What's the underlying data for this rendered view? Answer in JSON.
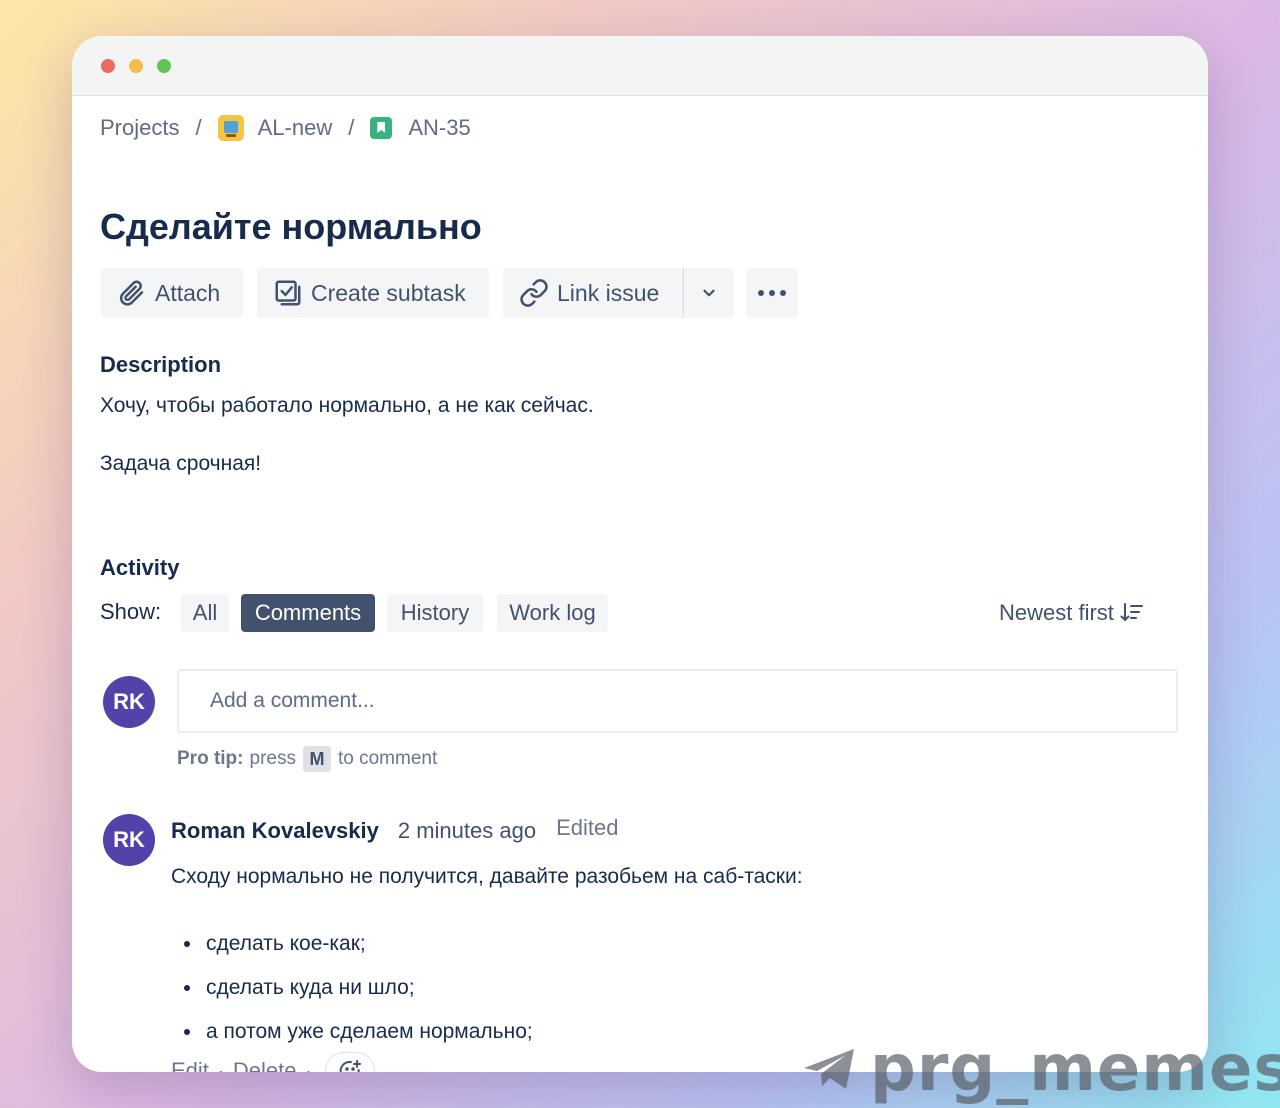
{
  "breadcrumb": {
    "projects": "Projects",
    "separator": "/",
    "project": "AL-new",
    "issue_key": "AN-35"
  },
  "issue": {
    "title": "Сделайте нормально"
  },
  "toolbar": {
    "attach": "Attach",
    "create_subtask": "Create subtask",
    "link_issue": "Link issue"
  },
  "description": {
    "heading": "Description",
    "paragraphs": [
      "Хочу, чтобы работало нормально, а не как сейчас.",
      "Задача срочная!"
    ]
  },
  "activity": {
    "heading": "Activity",
    "show_label": "Show:",
    "filters": [
      "All",
      "Comments",
      "History",
      "Work log"
    ],
    "active_filter": "Comments",
    "sort": "Newest first"
  },
  "comment_box": {
    "avatar_initials": "RK",
    "placeholder": "Add a comment...",
    "protip_label": "Pro tip:",
    "protip_before": "press",
    "protip_key": "M",
    "protip_after": "to comment"
  },
  "comment": {
    "avatar_initials": "RK",
    "author": "Roman Kovalevskiy",
    "time": "2 minutes ago",
    "edited": "Edited",
    "body": "Сходу нормально не получится, давайте разобьем на саб-таски:",
    "items": [
      "сделать кое-как;",
      "сделать куда ни шло;",
      "а потом уже сделаем нормально;"
    ],
    "actions": {
      "edit": "Edit",
      "delete": "Delete",
      "dot": "·"
    }
  },
  "watermark": {
    "text": "prg_memes",
    "icon": "telegram-plane-icon"
  },
  "colors": {
    "avatar": "#5243aa",
    "active_chip": "#42526e",
    "story_icon": "#36b37e",
    "title_text": "#172b4d"
  }
}
